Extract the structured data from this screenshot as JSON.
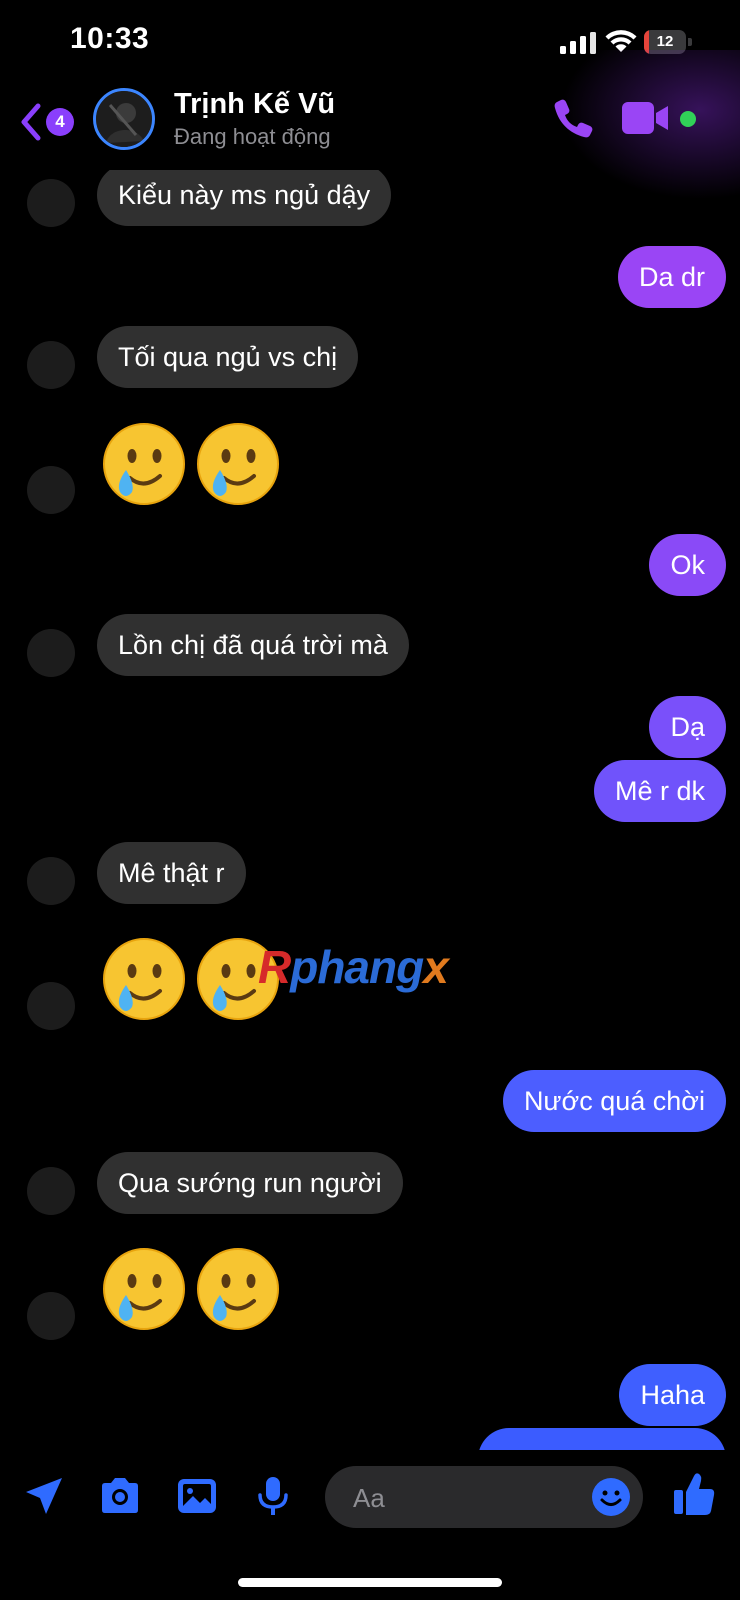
{
  "status_bar": {
    "time": "10:33",
    "battery_percent": "12",
    "battery_level": 0.12,
    "icons": [
      "cellular-signal-icon",
      "wifi-icon",
      "battery-icon"
    ]
  },
  "header": {
    "unread_count": "4",
    "contact_name": "Trịnh Kế Vũ",
    "contact_status": "Đang hoạt động",
    "icons": [
      "back-chevron-icon",
      "phone-icon",
      "video-camera-icon"
    ]
  },
  "messages": [
    {
      "direction": "in",
      "type": "text",
      "text": "Kiểu này ms ngủ dậy"
    },
    {
      "direction": "out",
      "type": "text",
      "text": "Da dr"
    },
    {
      "direction": "in",
      "type": "text",
      "text": "Tối qua ngủ vs chị"
    },
    {
      "direction": "in",
      "type": "emoji",
      "text": "🥲🥲"
    },
    {
      "direction": "out",
      "type": "text",
      "text": "Ok"
    },
    {
      "direction": "in",
      "type": "text",
      "text": "Lồn chị đã quá trời mà"
    },
    {
      "direction": "out",
      "type": "text",
      "text": "Dạ"
    },
    {
      "direction": "out",
      "type": "text",
      "text": "Mê r dk"
    },
    {
      "direction": "in",
      "type": "text",
      "text": "Mê thật r"
    },
    {
      "direction": "in",
      "type": "emoji",
      "text": "🥲🥲"
    },
    {
      "direction": "out",
      "type": "text",
      "text": "Nước quá chời"
    },
    {
      "direction": "in",
      "type": "text",
      "text": "Qua sướng run người"
    },
    {
      "direction": "in",
      "type": "emoji",
      "text": "🥲🥲"
    },
    {
      "direction": "out",
      "type": "text",
      "text": "Haha"
    }
  ],
  "watermark": {
    "part_a": "R",
    "part_b": "phang",
    "part_c": "x"
  },
  "composer": {
    "placeholder": "Aa",
    "icons": [
      "location-arrow-icon",
      "camera-icon",
      "image-icon",
      "microphone-icon",
      "smiley-icon",
      "thumbs-up-icon"
    ]
  },
  "colors": {
    "accent_purple": "#8a3ffc",
    "outgoing_top": "#9a45f5",
    "outgoing_bottom": "#3b5cff",
    "incoming_bubble": "#303030",
    "icon_blue": "#2f6bff",
    "online_green": "#31d158"
  }
}
